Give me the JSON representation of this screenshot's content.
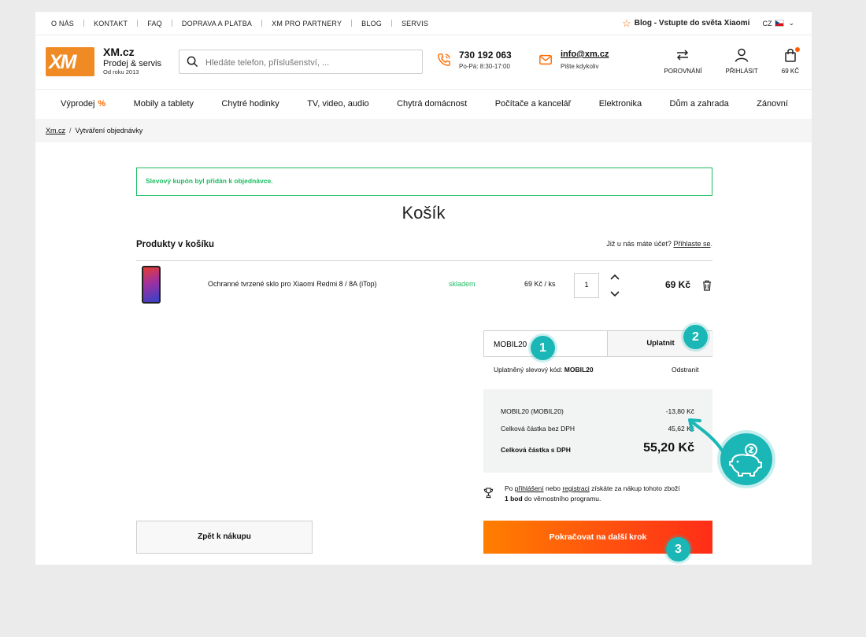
{
  "topnav": {
    "items": [
      "O NÁS",
      "KONTAKT",
      "FAQ",
      "DOPRAVA A PLATBA",
      "XM PRO PARTNERY",
      "BLOG",
      "SERVIS"
    ],
    "blog_link": "Blog - Vstupte do světa Xiaomi",
    "language": "CZ"
  },
  "header": {
    "logo_text": "XM",
    "brand_name": "XM.cz",
    "brand_tagline": "Prodej & servis",
    "brand_since": "Od roku 2013",
    "search_placeholder": "Hledáte telefon, příslušenství, ...",
    "phone": "730 192 063",
    "phone_hours": "Po-Pá: 8:30-17:00",
    "email": "info@xm.cz",
    "email_note": "Pište kdykoliv",
    "compare_label": "POROVNÁNÍ",
    "login_label": "PŘIHLÁSIT",
    "cart_label": "69 KČ"
  },
  "categories": [
    "Výprodej",
    "Mobily a tablety",
    "Chytré hodinky",
    "TV, video, audio",
    "Chytrá domácnost",
    "Počítače a kancelář",
    "Elektronika",
    "Dům a zahrada",
    "Zánovní"
  ],
  "sale_mark": "%",
  "breadcrumb": {
    "home": "Xm.cz",
    "separator": "/",
    "current": "Vytváření objednávky"
  },
  "notice": "Slevový kupón byl přidán k objednávce.",
  "cart": {
    "title": "Košík",
    "products_heading": "Produkty v košíku",
    "account_prompt": "Již u nás máte účet?",
    "account_link": "Přihlaste se",
    "account_dot": ".",
    "item": {
      "name": "Ochranné tvrzené sklo pro Xiaomi Redmi 8 / 8A (iTop)",
      "availability": "skladem",
      "unit_price": "69 Kč / ks",
      "quantity": "1",
      "line_total": "69 Kč"
    }
  },
  "coupon": {
    "value": "MOBIL20",
    "apply_label": "Uplatnit",
    "applied_prefix": "Uplatněný slevový kód:",
    "applied_code": "MOBIL20",
    "remove_label": "Odstranit"
  },
  "summary": {
    "discount_label": "MOBIL20 (MOBIL20)",
    "discount_value": "-13,80 Kč",
    "net_label": "Celková částka bez DPH",
    "net_value": "45,62 Kč",
    "total_label": "Celková částka s DPH",
    "total_value": "55,20 Kč"
  },
  "loyalty": {
    "prefix": "Po",
    "login_link": "přihlášení",
    "middle": "nebo",
    "register_link": "registraci",
    "suffix": "získáte za nákup tohoto zboží",
    "points": "1 bod",
    "end": "do věrnostního programu."
  },
  "buttons": {
    "back": "Zpět k nákupu",
    "next": "Pokračovat na další krok"
  },
  "annotations": {
    "step1": "1",
    "step2": "2",
    "step3": "3"
  },
  "colors": {
    "accent": "#ff6b00",
    "success": "#1ebd63",
    "annotation": "#1ab7b6"
  }
}
